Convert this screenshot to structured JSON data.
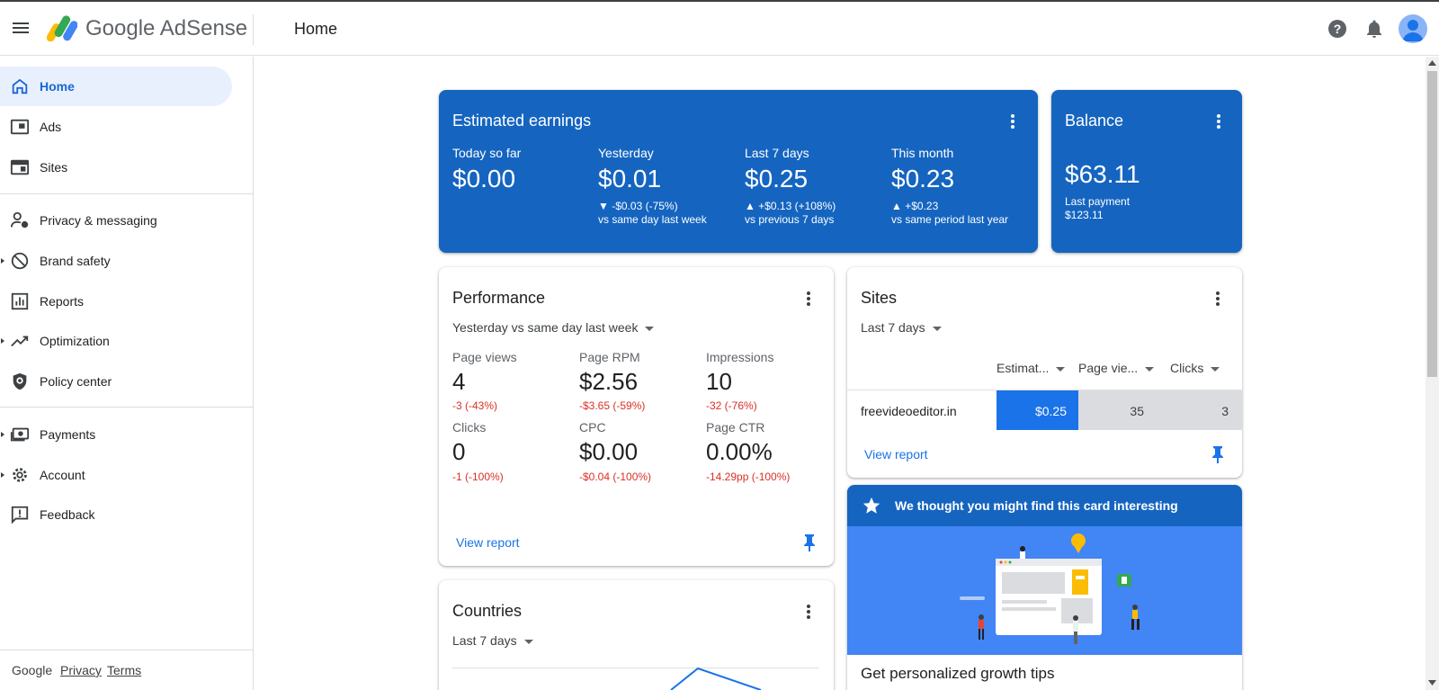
{
  "header": {
    "brand": "Google AdSense",
    "page_title": "Home"
  },
  "colors": {
    "accent_blue": "#1565c0",
    "active_nav_bg": "#e8f0fe",
    "negative_red": "#d93025",
    "link_blue": "#1a73e8"
  },
  "sidebar": {
    "items": [
      {
        "label": "Home",
        "icon": "home-icon"
      },
      {
        "label": "Ads",
        "icon": "ads-icon"
      },
      {
        "label": "Sites",
        "icon": "sites-icon"
      },
      {
        "label": "Privacy & messaging",
        "icon": "privacy-icon"
      },
      {
        "label": "Brand safety",
        "icon": "block-icon"
      },
      {
        "label": "Reports",
        "icon": "reports-icon"
      },
      {
        "label": "Optimization",
        "icon": "trending-icon"
      },
      {
        "label": "Policy center",
        "icon": "shield-icon"
      },
      {
        "label": "Payments",
        "icon": "payments-icon"
      },
      {
        "label": "Account",
        "icon": "gear-icon"
      },
      {
        "label": "Feedback",
        "icon": "feedback-icon"
      }
    ],
    "footer": {
      "google": "Google",
      "privacy": "Privacy",
      "terms": "Terms"
    }
  },
  "earnings": {
    "title": "Estimated earnings",
    "metrics": [
      {
        "label": "Today so far",
        "value": "$0.00",
        "change": "",
        "compare": ""
      },
      {
        "label": "Yesterday",
        "value": "$0.01",
        "change": "▼ -$0.03 (-75%)",
        "compare": "vs same day last week"
      },
      {
        "label": "Last 7 days",
        "value": "$0.25",
        "change": "▲ +$0.13 (+108%)",
        "compare": "vs previous 7 days"
      },
      {
        "label": "This month",
        "value": "$0.23",
        "change": "▲ +$0.23",
        "compare": "vs same period last year"
      }
    ]
  },
  "balance": {
    "title": "Balance",
    "value": "$63.11",
    "last_payment_label": "Last payment",
    "last_payment_value": "$123.11"
  },
  "performance": {
    "title": "Performance",
    "range": "Yesterday vs same day last week",
    "metrics": [
      {
        "label": "Page views",
        "value": "4",
        "delta": "-3 (-43%)"
      },
      {
        "label": "Page RPM",
        "value": "$2.56",
        "delta": "-$3.65 (-59%)"
      },
      {
        "label": "Impressions",
        "value": "10",
        "delta": "-32 (-76%)"
      },
      {
        "label": "Clicks",
        "value": "0",
        "delta": "-1 (-100%)"
      },
      {
        "label": "CPC",
        "value": "$0.00",
        "delta": "-$0.04 (-100%)"
      },
      {
        "label": "Page CTR",
        "value": "0.00%",
        "delta": "-14.29pp (-100%)"
      }
    ],
    "link": "View report"
  },
  "sites": {
    "title": "Sites",
    "range": "Last 7 days",
    "columns": [
      "Estimat...",
      "Page vie...",
      "Clicks"
    ],
    "rows": [
      {
        "site": "freevideoeditor.in",
        "earnings": "$0.25",
        "page_views": "35",
        "clicks": "3"
      }
    ],
    "link": "View report"
  },
  "countries": {
    "title": "Countries",
    "range": "Last 7 days"
  },
  "interesting": {
    "banner": "We thought you might find this card interesting",
    "tip_title": "Get personalized growth tips"
  }
}
